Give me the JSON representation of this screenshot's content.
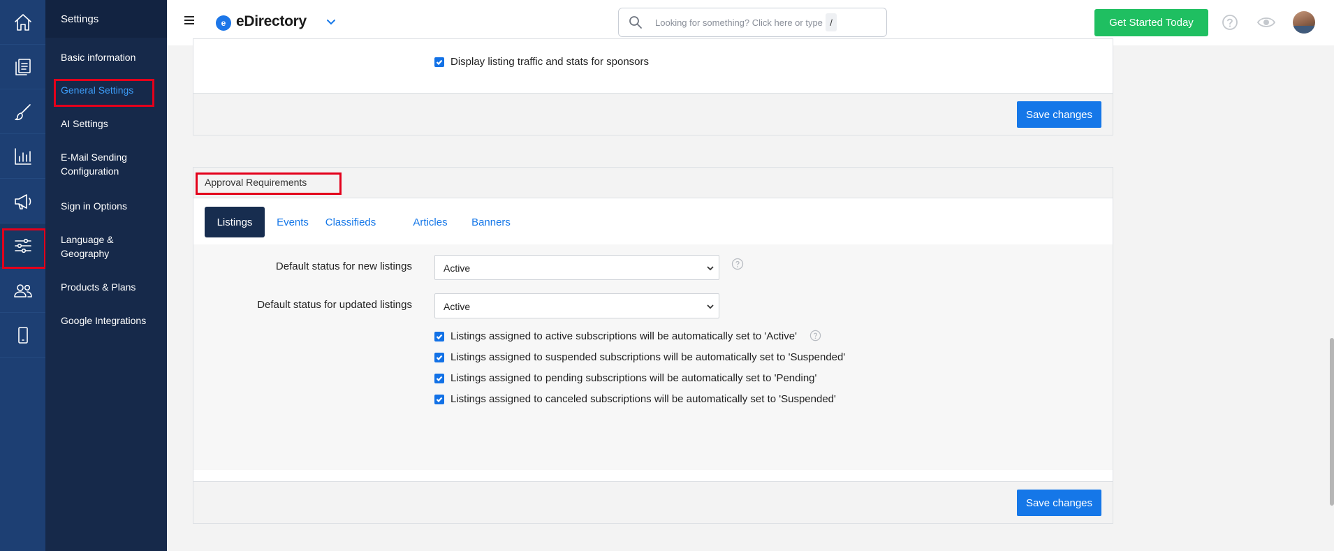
{
  "app": {
    "brand": "eDirectory",
    "brand_initial": "e"
  },
  "header": {
    "search_placeholder": "Looking for something? Click here or type",
    "search_shortcut": "/",
    "cta_label": "Get Started Today"
  },
  "rail": {
    "icons": [
      "home-icon",
      "pages-icon",
      "brush-icon",
      "chart-icon",
      "megaphone-icon",
      "settings-sliders-icon",
      "users-icon",
      "mobile-icon"
    ],
    "active": "settings-sliders-icon"
  },
  "settings_menu": {
    "title": "Settings",
    "items": [
      {
        "label": "Basic information"
      },
      {
        "label": "General Settings",
        "active": true
      },
      {
        "label": "AI Settings"
      },
      {
        "label": "E-Mail Sending Configuration"
      },
      {
        "label": "Sign in Options"
      },
      {
        "label": "Language & Geography"
      },
      {
        "label": "Products & Plans"
      },
      {
        "label": "Google Integrations"
      }
    ]
  },
  "sponsor_panel": {
    "checkbox_label": "Display listing traffic and stats for sponsors",
    "checked": true,
    "save_label": "Save changes"
  },
  "approval_panel": {
    "title": "Approval Requirements",
    "tabs": [
      "Listings",
      "Events",
      "Classifieds",
      "Articles",
      "Banners"
    ],
    "active_tab": "Listings",
    "fields": [
      {
        "label": "Default status for new listings",
        "value": "Active"
      },
      {
        "label": "Default status for updated listings",
        "value": "Active"
      }
    ],
    "checkboxes": [
      {
        "label": "Listings assigned to active subscriptions will be automatically set to 'Active'",
        "checked": true
      },
      {
        "label": "Listings assigned to suspended subscriptions will be automatically set to 'Suspended'",
        "checked": true
      },
      {
        "label": "Listings assigned to pending subscriptions will be automatically set to 'Pending'",
        "checked": true
      },
      {
        "label": "Listings assigned to canceled subscriptions will be automatically set to 'Suspended'",
        "checked": true
      }
    ],
    "save_label": "Save changes"
  },
  "colors": {
    "rail_bg": "#1d3f73",
    "menu_bg": "#16294a",
    "accent": "#1577e8",
    "cta": "#1fbf61",
    "highlight": "#e3001b"
  }
}
